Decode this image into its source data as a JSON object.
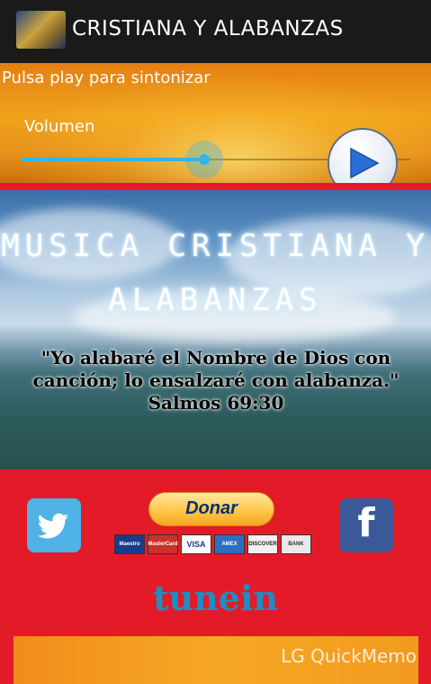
{
  "app": {
    "title": "CRISTIANA Y ALABANZAS",
    "icon": "app-icon"
  },
  "player": {
    "hint": "Pulsa play para sintonizar",
    "volume_label": "Volumen",
    "volume_level": 0.47,
    "play_icon": "play-icon",
    "accent_color": "#33b5e5"
  },
  "banner": {
    "title_line1": "MUSICA CRISTIANA Y",
    "title_line2": "ALABANZAS",
    "verse_line1": "\"Yo alabaré el Nombre de Dios con",
    "verse_line2": "canción; lo ensalzaré con alabanza.\"",
    "verse_ref": "Salmos 69:30"
  },
  "social": {
    "donate_label": "Donar",
    "cards": [
      "Maestro",
      "MasterCard",
      "VISA",
      "AMEX",
      "DISCOVER",
      "BANK"
    ],
    "twitter_icon": "twitter-icon",
    "facebook_icon": "facebook-icon",
    "tunein_label": "tunein",
    "watermark": "LG QuickMemo"
  },
  "colors": {
    "background": "#e31b28",
    "topbar": "#1a1a1a",
    "twitter": "#4fb3e6",
    "facebook": "#3b5998",
    "tunein": "#1d8fc4"
  }
}
